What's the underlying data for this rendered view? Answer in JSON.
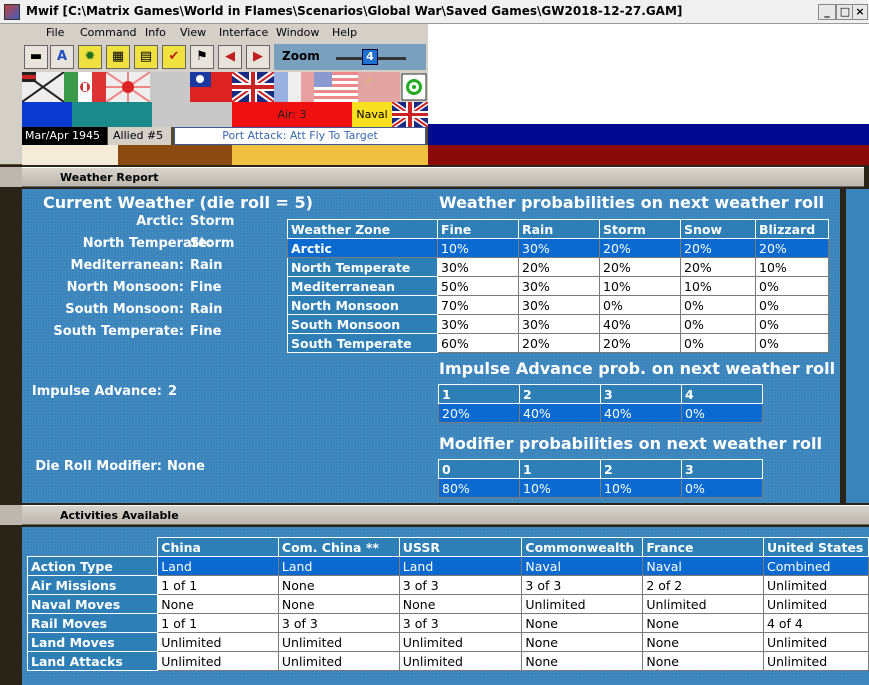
{
  "window": {
    "title": "Mwif [C:\\Matrix Games\\World in Flames\\Scenarios\\Global War\\Saved Games\\GW2018-12-27.GAM]",
    "min_label": "_",
    "max_label": "□",
    "close_label": "×"
  },
  "menu": [
    "File",
    "Command",
    "Info",
    "View",
    "Interface",
    "Window",
    "Help"
  ],
  "toolbar": {
    "buttons": [
      {
        "icon": "train-icon",
        "glyph": "▬"
      },
      {
        "icon": "letter-a-icon",
        "glyph": "A"
      },
      {
        "icon": "gear-icon",
        "glyph": "✹"
      },
      {
        "icon": "map-icon",
        "glyph": "▦"
      },
      {
        "icon": "card-icon",
        "glyph": "▤"
      },
      {
        "icon": "check-icon",
        "glyph": "✔"
      },
      {
        "icon": "flag-icon",
        "glyph": "⚑"
      },
      {
        "icon": "left-arrow-icon",
        "glyph": "◀"
      },
      {
        "icon": "right-arrow-icon",
        "glyph": "▶"
      }
    ],
    "zoom_label": "Zoom",
    "zoom_value": "4"
  },
  "status": {
    "date": "Mar/Apr 1945",
    "allied": "Allied #5",
    "phase": "Port Attack: Att Fly To Target",
    "air": "Air: 3",
    "naval": "Naval"
  },
  "weather_window": {
    "title": "Weather Report",
    "current_heading": "Current Weather (die roll = 5)",
    "zones": [
      {
        "label": "Arctic:",
        "value": "Storm"
      },
      {
        "label": "North Temperate:",
        "value": "Storm"
      },
      {
        "label": "Mediterranean:",
        "value": "Rain"
      },
      {
        "label": "North Monsoon:",
        "value": "Fine"
      },
      {
        "label": "South Monsoon:",
        "value": "Rain"
      },
      {
        "label": "South Temperate:",
        "value": "Fine"
      }
    ],
    "impulse_label": "Impulse Advance:",
    "impulse_value": "2",
    "modifier_label": "Die Roll Modifier:",
    "modifier_value": "None",
    "prob_heading": "Weather probabilities on next weather roll",
    "prob_headers": [
      "Weather Zone",
      "Fine",
      "Rain",
      "Storm",
      "Snow",
      "Blizzard"
    ],
    "prob_rows": [
      [
        "Arctic",
        "10%",
        "30%",
        "20%",
        "20%",
        "20%"
      ],
      [
        "North Temperate",
        "30%",
        "20%",
        "20%",
        "20%",
        "10%"
      ],
      [
        "Mediterranean",
        "50%",
        "30%",
        "10%",
        "10%",
        "0%"
      ],
      [
        "North Monsoon",
        "70%",
        "30%",
        "0%",
        "0%",
        "0%"
      ],
      [
        "South Monsoon",
        "30%",
        "30%",
        "40%",
        "0%",
        "0%"
      ],
      [
        "South Temperate",
        "60%",
        "20%",
        "20%",
        "0%",
        "0%"
      ]
    ],
    "impulse_heading": "Impulse Advance prob. on next weather roll",
    "impulse_headers": [
      "1",
      "2",
      "3",
      "4"
    ],
    "impulse_values": [
      "20%",
      "40%",
      "40%",
      "0%"
    ],
    "modifier_heading": "Modifier probabilities on next weather roll",
    "modifier_headers": [
      "0",
      "1",
      "2",
      "3"
    ],
    "modifier_values": [
      "80%",
      "10%",
      "10%",
      "0%"
    ]
  },
  "activities_window": {
    "title": "Activities Available",
    "headers": [
      "",
      "China",
      "Com. China **",
      "USSR",
      "Commonwealth",
      "France",
      "United States"
    ],
    "rows": [
      [
        "Action Type",
        "Land",
        "Land",
        "Land",
        "Naval",
        "Naval",
        "Combined"
      ],
      [
        "Air Missions",
        "1 of 1",
        "None",
        "3 of 3",
        "3 of 3",
        "2 of 2",
        "Unlimited"
      ],
      [
        "Naval Moves",
        "None",
        "None",
        "None",
        "Unlimited",
        "Unlimited",
        "Unlimited"
      ],
      [
        "Rail Moves",
        "1 of 1",
        "3 of 3",
        "3 of 3",
        "None",
        "None",
        "4 of 4"
      ],
      [
        "Land Moves",
        "Unlimited",
        "Unlimited",
        "Unlimited",
        "None",
        "None",
        "Unlimited"
      ],
      [
        "Land Attacks",
        "Unlimited",
        "Unlimited",
        "Unlimited",
        "None",
        "None",
        "Unlimited"
      ]
    ]
  },
  "colors": {
    "pane_blue": "#3a84bc",
    "header_blue": "#2d7fb6",
    "selected_blue": "#0a6ad0"
  }
}
